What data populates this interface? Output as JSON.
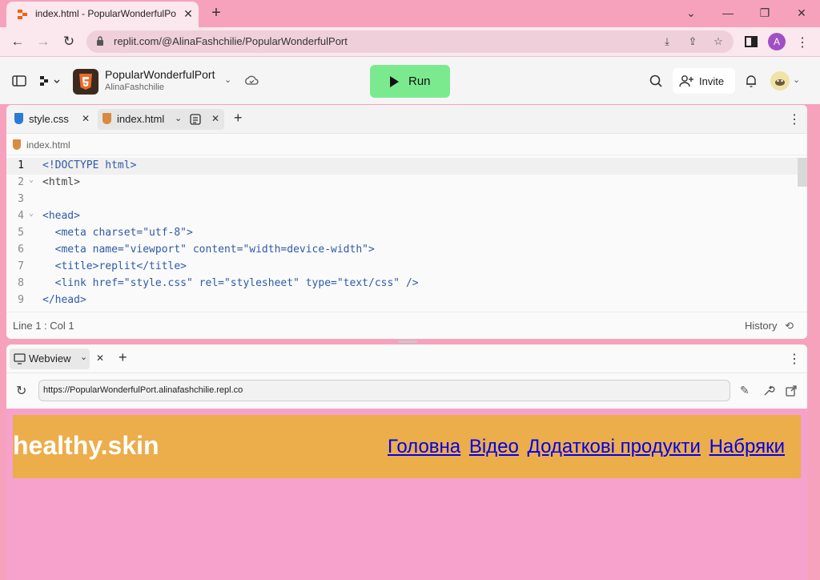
{
  "browser": {
    "tab_title": "index.html - PopularWonderfulPo",
    "url": "replit.com/@AlinaFashchilie/PopularWonderfulPort",
    "profile_initial": "A"
  },
  "replit": {
    "repl_name": "PopularWonderfulPort",
    "owner": "AlinaFashchilie",
    "run_label": "Run",
    "invite_label": "Invite"
  },
  "editor": {
    "tabs": [
      {
        "label": "style.css"
      },
      {
        "label": "index.html"
      }
    ],
    "breadcrumb": "index.html",
    "status": "Line 1 : Col 1",
    "history_label": "History",
    "lines": [
      {
        "n": "1",
        "text": "<!DOCTYPE html>"
      },
      {
        "n": "2",
        "text": "<html>"
      },
      {
        "n": "3",
        "text": ""
      },
      {
        "n": "4",
        "text": "<head>"
      },
      {
        "n": "5",
        "text": "  <meta charset=\"utf-8\">"
      },
      {
        "n": "6",
        "text": "  <meta name=\"viewport\" content=\"width=device-width\">"
      },
      {
        "n": "7",
        "text": "  <title>replit</title>"
      },
      {
        "n": "8",
        "text": "  <link href=\"style.css\" rel=\"stylesheet\" type=\"text/css\" />"
      },
      {
        "n": "9",
        "text": "</head>"
      }
    ]
  },
  "webview": {
    "tab_label": "Webview",
    "url": "https://PopularWonderfulPort.alinafashchilie.repl.co",
    "site": {
      "logo": "healthy.skin",
      "nav": [
        "Головна",
        "Відео",
        "Додаткові продукти",
        "Набряки"
      ]
    }
  }
}
